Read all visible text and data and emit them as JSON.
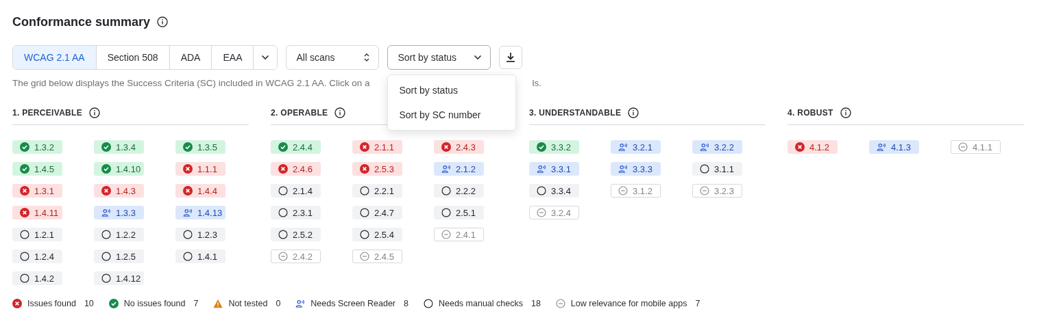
{
  "title": "Conformance summary",
  "tabs": [
    {
      "label": "WCAG 2.1 AA",
      "selected": true
    },
    {
      "label": "Section 508",
      "selected": false
    },
    {
      "label": "ADA",
      "selected": false
    },
    {
      "label": "EAA",
      "selected": false
    }
  ],
  "scan_select": {
    "value": "All scans"
  },
  "sort_select": {
    "value": "Sort by status",
    "expanded": true,
    "options": [
      "Sort by status",
      "Sort by SC number"
    ]
  },
  "description_start": "The grid below displays the Success Criteria (SC) included in WCAG 2.1 AA. Click on a",
  "description_end": "ls.",
  "sections": [
    {
      "title": "1. PERCEIVABLE",
      "criteria": [
        {
          "label": "1.3.2",
          "kind": "pass"
        },
        {
          "label": "1.3.4",
          "kind": "pass"
        },
        {
          "label": "1.3.5",
          "kind": "pass"
        },
        {
          "label": "1.4.5",
          "kind": "pass"
        },
        {
          "label": "1.4.10",
          "kind": "pass"
        },
        {
          "label": "1.1.1",
          "kind": "fail"
        },
        {
          "label": "1.3.1",
          "kind": "fail"
        },
        {
          "label": "1.4.3",
          "kind": "fail"
        },
        {
          "label": "1.4.4",
          "kind": "fail"
        },
        {
          "label": "1.4.11",
          "kind": "fail"
        },
        {
          "label": "1.3.3",
          "kind": "reader"
        },
        {
          "label": "1.4.13",
          "kind": "reader"
        },
        {
          "label": "1.2.1",
          "kind": "manual"
        },
        {
          "label": "1.2.2",
          "kind": "manual"
        },
        {
          "label": "1.2.3",
          "kind": "manual"
        },
        {
          "label": "1.2.4",
          "kind": "manual"
        },
        {
          "label": "1.2.5",
          "kind": "manual"
        },
        {
          "label": "1.4.1",
          "kind": "manual"
        },
        {
          "label": "1.4.2",
          "kind": "manual"
        },
        {
          "label": "1.4.12",
          "kind": "manual"
        }
      ]
    },
    {
      "title": "2. OPERABLE",
      "criteria": [
        {
          "label": "2.4.4",
          "kind": "pass"
        },
        {
          "label": "2.1.1",
          "kind": "fail"
        },
        {
          "label": "2.4.3",
          "kind": "fail"
        },
        {
          "label": "2.4.6",
          "kind": "fail"
        },
        {
          "label": "2.5.3",
          "kind": "fail"
        },
        {
          "label": "2.1.2",
          "kind": "reader"
        },
        {
          "label": "2.1.4",
          "kind": "manual"
        },
        {
          "label": "2.2.1",
          "kind": "manual"
        },
        {
          "label": "2.2.2",
          "kind": "manual"
        },
        {
          "label": "2.3.1",
          "kind": "manual"
        },
        {
          "label": "2.4.7",
          "kind": "manual"
        },
        {
          "label": "2.5.1",
          "kind": "manual"
        },
        {
          "label": "2.5.2",
          "kind": "manual"
        },
        {
          "label": "2.5.4",
          "kind": "manual"
        },
        {
          "label": "2.4.1",
          "kind": "low"
        },
        {
          "label": "2.4.2",
          "kind": "low"
        },
        {
          "label": "2.4.5",
          "kind": "low"
        }
      ]
    },
    {
      "title": "3. UNDERSTANDABLE",
      "criteria": [
        {
          "label": "3.3.2",
          "kind": "pass"
        },
        {
          "label": "3.2.1",
          "kind": "reader"
        },
        {
          "label": "3.2.2",
          "kind": "reader"
        },
        {
          "label": "3.3.1",
          "kind": "reader"
        },
        {
          "label": "3.3.3",
          "kind": "reader"
        },
        {
          "label": "3.1.1",
          "kind": "manual"
        },
        {
          "label": "3.3.4",
          "kind": "manual"
        },
        {
          "label": "3.1.2",
          "kind": "low"
        },
        {
          "label": "3.2.3",
          "kind": "low"
        },
        {
          "label": "3.2.4",
          "kind": "low"
        }
      ]
    },
    {
      "title": "4. ROBUST",
      "criteria": [
        {
          "label": "4.1.2",
          "kind": "fail"
        },
        {
          "label": "4.1.3",
          "kind": "reader"
        },
        {
          "label": "4.1.1",
          "kind": "low"
        }
      ]
    }
  ],
  "legend": [
    {
      "kind": "fail",
      "label": "Issues found",
      "count": "10"
    },
    {
      "kind": "pass",
      "label": "No issues found",
      "count": "7"
    },
    {
      "kind": "untested",
      "label": "Not tested",
      "count": "0"
    },
    {
      "kind": "reader",
      "label": "Needs Screen Reader",
      "count": "8"
    },
    {
      "kind": "manual",
      "label": "Needs manual checks",
      "count": "18"
    },
    {
      "kind": "low",
      "label": "Low relevance for mobile apps",
      "count": "7"
    }
  ]
}
